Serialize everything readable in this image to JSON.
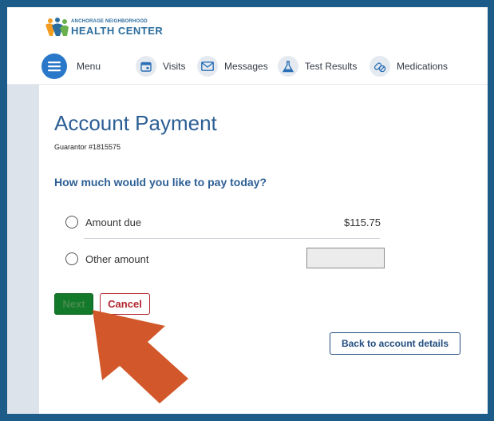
{
  "header": {
    "logo_small": "ANCHORAGE NEIGHBORHOOD",
    "logo_big": "HEALTH CENTER"
  },
  "nav": {
    "items": [
      {
        "label": "Menu",
        "icon": "menu-icon"
      },
      {
        "label": "Visits",
        "icon": "calendar-icon"
      },
      {
        "label": "Messages",
        "icon": "envelope-icon"
      },
      {
        "label": "Test Results",
        "icon": "flask-icon"
      },
      {
        "label": "Medications",
        "icon": "pills-icon"
      }
    ]
  },
  "page": {
    "title": "Account Payment",
    "subtitle": "Guarantor #1815575",
    "question": "How much would you like to pay today?"
  },
  "options": {
    "amount_due_label": "Amount due",
    "amount_due_value": "$115.75",
    "other_label": "Other amount",
    "other_value": ""
  },
  "buttons": {
    "next": "Next",
    "cancel": "Cancel",
    "back": "Back to account details"
  },
  "colors": {
    "brand_blue": "#2d5f95",
    "next_green": "#127a2a",
    "cancel_red": "#b3262d",
    "annotation_arrow": "#d2572a"
  }
}
